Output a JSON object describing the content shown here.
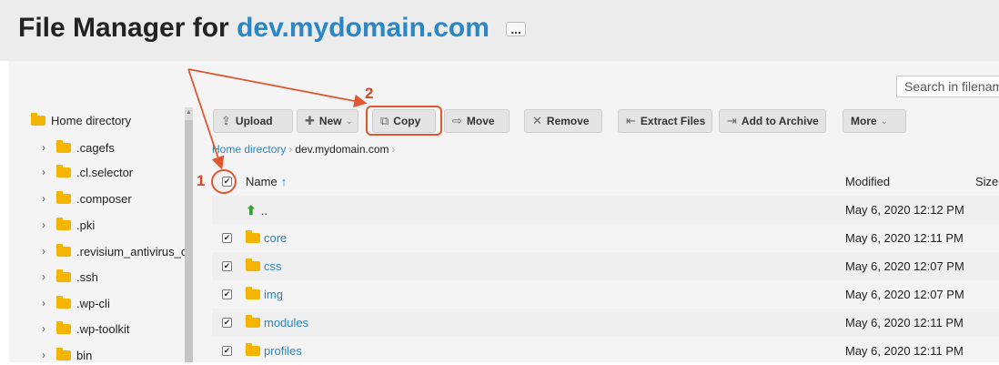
{
  "header": {
    "title_prefix": "File Manager for",
    "domain": "dev.mydomain.com",
    "more_label": "..."
  },
  "search": {
    "placeholder": "Search in filename"
  },
  "sidebar": {
    "items": [
      {
        "label": "Home directory",
        "expanded": true
      },
      {
        "label": ".cagefs"
      },
      {
        "label": ".cl.selector"
      },
      {
        "label": ".composer"
      },
      {
        "label": ".pki"
      },
      {
        "label": ".revisium_antivirus_ca"
      },
      {
        "label": ".ssh"
      },
      {
        "label": ".wp-cli"
      },
      {
        "label": ".wp-toolkit"
      },
      {
        "label": "bin"
      }
    ]
  },
  "toolbar": {
    "upload": "Upload",
    "new": "New",
    "copy": "Copy",
    "move": "Move",
    "remove": "Remove",
    "extract": "Extract Files",
    "archive": "Add to Archive",
    "more": "More"
  },
  "breadcrumb": {
    "home": "Home directory",
    "current": "dev.mydomain.com"
  },
  "table": {
    "columns": {
      "name": "Name",
      "sort_indicator": "↑",
      "modified": "Modified",
      "size": "Size"
    },
    "rows": [
      {
        "name": "..",
        "modified": "May 6, 2020 12:12 PM",
        "type": "up",
        "checked": false
      },
      {
        "name": "core",
        "modified": "May 6, 2020 12:11 PM",
        "type": "folder",
        "checked": true
      },
      {
        "name": "css",
        "modified": "May 6, 2020 12:07 PM",
        "type": "folder",
        "checked": true
      },
      {
        "name": "img",
        "modified": "May 6, 2020 12:07 PM",
        "type": "folder",
        "checked": true
      },
      {
        "name": "modules",
        "modified": "May 6, 2020 12:11 PM",
        "type": "folder",
        "checked": true
      },
      {
        "name": "profiles",
        "modified": "May 6, 2020 12:11 PM",
        "type": "folder",
        "checked": true
      }
    ]
  },
  "annotations": {
    "step1": "1",
    "step2": "2",
    "color": "#e0562e"
  },
  "colors": {
    "accent": "#2a86c4",
    "folder": "#f4b400"
  }
}
